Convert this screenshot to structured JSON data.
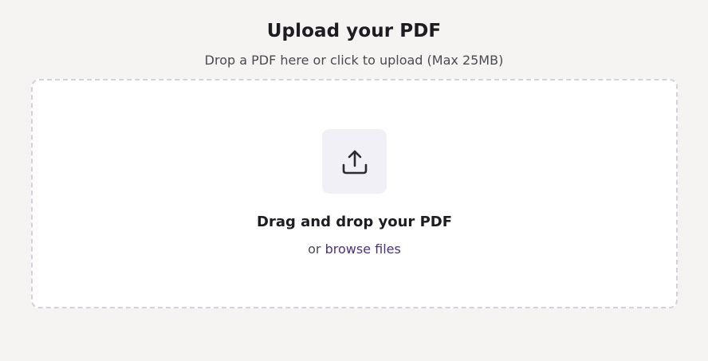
{
  "header": {
    "title": "Upload your PDF",
    "subtitle": "Drop a PDF here or click to upload (Max 25MB)"
  },
  "dropzone": {
    "heading": "Drag and drop your PDF",
    "prefix": "or",
    "browse_label": "browse files",
    "icon": "upload-icon"
  },
  "colors": {
    "background": "#f5f4f2",
    "card": "#ffffff",
    "border": "#d4d0dc",
    "icon_bg": "#f1f0f6",
    "link": "#4b2f86",
    "text": "#1c1c22"
  }
}
